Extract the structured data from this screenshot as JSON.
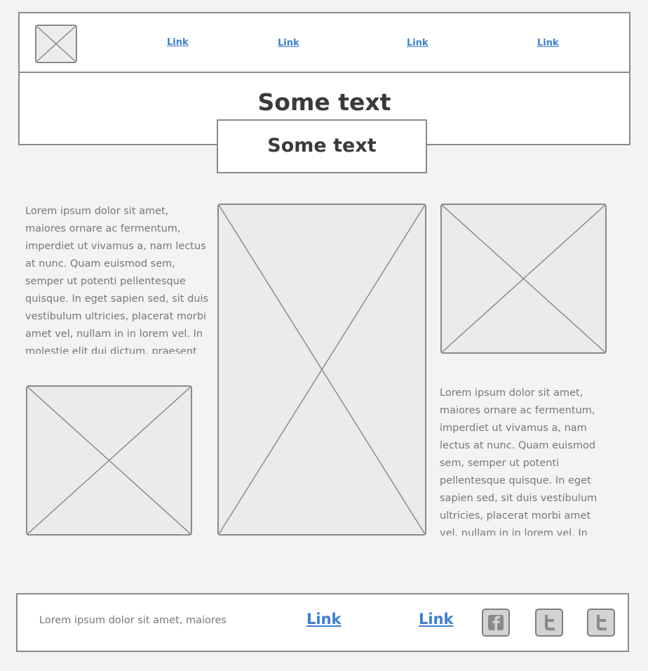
{
  "header": {
    "logo_icon": "image-placeholder-icon",
    "nav_links": [
      "Link",
      "Link",
      "Link",
      "Link"
    ],
    "title": "Some text"
  },
  "subtitle": "Some text",
  "left_column": {
    "paragraph": "Lorem ipsum dolor sit amet, maiores ornare ac fermentum, imperdiet ut vivamus a, nam lectus at nunc. Quam euismod sem, semper ut potenti pellentesque quisque. In eget sapien sed, sit duis vestibulum ultricies, placerat morbi amet vel, nullam in in lorem vel. In molestie elit dui dictum, praesent"
  },
  "right_column": {
    "paragraph": "Lorem ipsum dolor sit amet, maiores ornare ac fermentum, imperdiet ut vivamus a, nam lectus at nunc. Quam euismod sem, semper ut potenti pellentesque quisque. In eget sapien sed, sit duis vestibulum ultricies, placerat morbi amet vel, nullam in in lorem vel. In"
  },
  "footer": {
    "text": "Lorem ipsum dolor sit amet, maiores",
    "links": [
      "Link",
      "Link"
    ],
    "social_icons": [
      "facebook-icon",
      "twitter-icon",
      "twitter-icon"
    ]
  },
  "colors": {
    "background": "#f3f3f3",
    "border": "#8a8a8a",
    "link": "#3b7fd0",
    "heading": "#3a3a3a",
    "body_text": "#777777"
  }
}
